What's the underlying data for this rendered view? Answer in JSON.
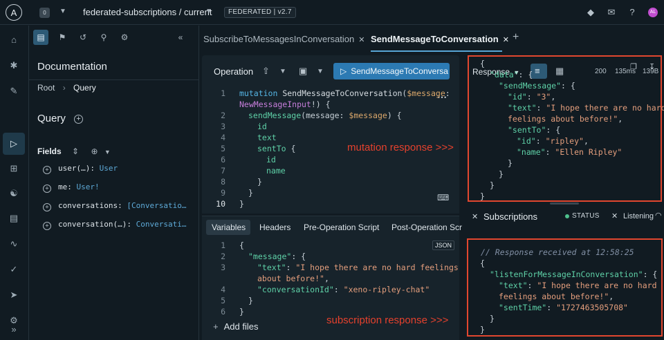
{
  "topbar": {
    "logo": "A",
    "org_badge": "0",
    "graph_name": "federated-subscriptions / current",
    "badge": "FEDERATED | v2.7",
    "avatar": "AL"
  },
  "docs": {
    "title": "Documentation",
    "breadcrumb": [
      "Root",
      "Query"
    ],
    "query_title": "Query",
    "fields_title": "Fields",
    "fields": [
      {
        "name": "user(…): ",
        "type": "User"
      },
      {
        "name": "me: ",
        "type": "User!"
      },
      {
        "name": "conversations: ",
        "type": "[Conversatio…"
      },
      {
        "name": "conversation(…): ",
        "type": "Conversati…"
      }
    ]
  },
  "tabs": [
    {
      "label": "SubscribeToMessagesInConversation",
      "active": false
    },
    {
      "label": "SendMessageToConversation",
      "active": true
    }
  ],
  "operation": {
    "title": "Operation",
    "run_label": "SendMessageToConversa"
  },
  "variables": {
    "tabs": [
      "Variables",
      "Headers",
      "Pre-Operation Script",
      "Post-Operation Scr"
    ],
    "json_badge": "JSON",
    "add_files": "Add files"
  },
  "response": {
    "label": "Response",
    "status_code": "200",
    "time": "135ms",
    "size": "139B"
  },
  "subscriptions": {
    "title": "Subscriptions",
    "status": "STATUS",
    "listening": "Listening",
    "comment": "// Response received at 12:58:25"
  },
  "annotations": {
    "mutation": "mutation response >>>",
    "subscription": "subscription response >>>"
  },
  "colors": {
    "accent": "#2c7ab3",
    "highlight_box": "#e2472f",
    "status_ok": "#4ec08c"
  }
}
